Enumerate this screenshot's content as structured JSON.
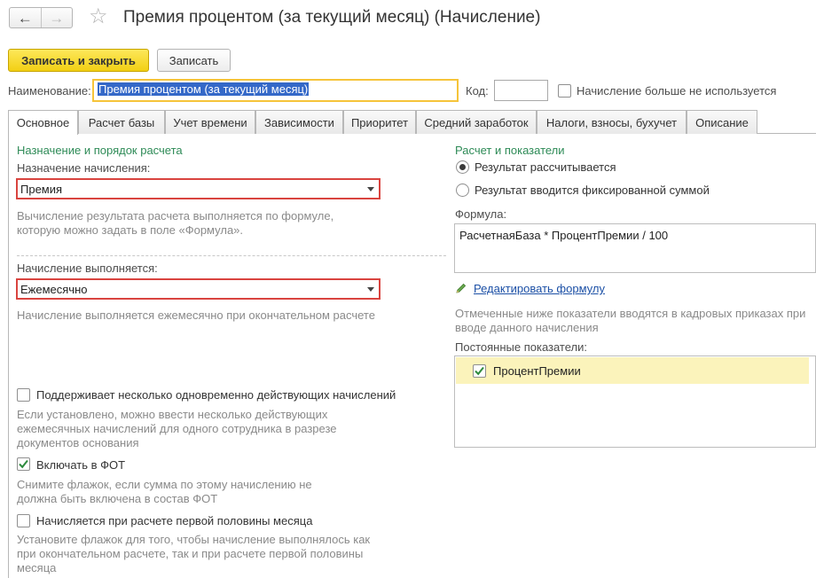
{
  "window": {
    "title": "Премия процентом (за текущий месяц) (Начисление)",
    "back_icon": "arrow-left-icon",
    "forward_icon": "arrow-right-icon",
    "favorite_icon": "star-icon"
  },
  "toolbar": {
    "save_close_label": "Записать и закрыть",
    "save_label": "Записать"
  },
  "header": {
    "name_label": "Наименование:",
    "name_value": "Премия процентом (за текущий месяц)",
    "code_label": "Код:",
    "code_value": "",
    "not_used_label": "Начисление больше не используется",
    "not_used_checked": false
  },
  "tabs": [
    {
      "label": "Основное",
      "active": true
    },
    {
      "label": "Расчет базы",
      "active": false
    },
    {
      "label": "Учет времени",
      "active": false
    },
    {
      "label": "Зависимости",
      "active": false
    },
    {
      "label": "Приоритет",
      "active": false
    },
    {
      "label": "Средний заработок",
      "active": false
    },
    {
      "label": "Налоги, взносы, бухучет",
      "active": false
    },
    {
      "label": "Описание",
      "active": false
    }
  ],
  "left": {
    "section_title": "Назначение и порядок расчета",
    "purpose_label": "Назначение начисления:",
    "purpose_value": "Премия",
    "purpose_hint_1": "Вычисление результата расчета выполняется по формуле,",
    "purpose_hint_2": "которую можно задать в поле «Формула».",
    "period_label": "Начисление выполняется:",
    "period_value": "Ежемесячно",
    "period_hint": "Начисление выполняется ежемесячно при окончательном расчете",
    "multi_label": "Поддерживает несколько одновременно действующих начислений",
    "multi_checked": false,
    "multi_hint_1": "Если установлено, можно ввести несколько действующих",
    "multi_hint_2": "ежемесячных начислений для одного сотрудника в разрезе",
    "multi_hint_3": "документов основания",
    "fot_label": "Включать в ФОТ",
    "fot_checked": true,
    "fot_hint_1": "Снимите флажок, если сумма по этому начислению не",
    "fot_hint_2": "должна быть включена в состав ФОТ",
    "half_label": "Начисляется при расчете первой половины месяца",
    "half_checked": false,
    "half_hint_1": "Установите флажок для того, чтобы начисление выполнялось как",
    "half_hint_2": "при окончательном расчете, так и при расчете первой половины",
    "half_hint_3": "месяца"
  },
  "right": {
    "section_title": "Расчет и показатели",
    "radio_calculated": "Результат рассчитывается",
    "radio_fixed": "Результат вводится фиксированной суммой",
    "selected_radio": "calculated",
    "formula_label": "Формула:",
    "formula_value": "РасчетнаяБаза * ПроцентПремии / 100",
    "edit_formula_link": "Редактировать формулу",
    "indicators_hint_1": "Отмеченные ниже показатели вводятся в кадровых приказах при",
    "indicators_hint_2": "вводе данного начисления",
    "constant_label": "Постоянные показатели:",
    "constant_items": [
      {
        "label": "ПроцентПремии",
        "checked": true
      }
    ]
  },
  "colors": {
    "primary_button": "#f2cf14",
    "section_title": "#2e8b57",
    "highlight_border": "#d9443f",
    "focus_border": "#f6c43a",
    "link": "#1c50a6",
    "selected_row": "#fbf3bb"
  }
}
